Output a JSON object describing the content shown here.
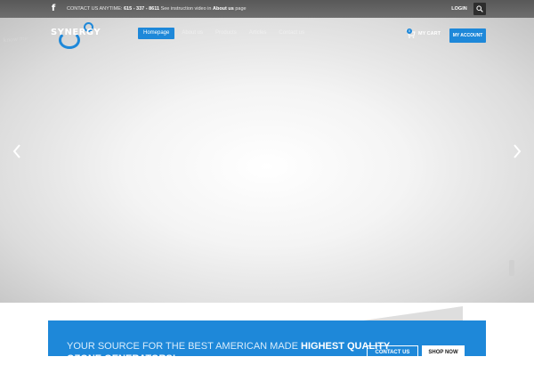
{
  "topbar": {
    "facebook_icon": "facebook-icon",
    "contact_prefix": "CONTACT US ANYTIME:",
    "phone": "615 - 337 - 8611",
    "video_text": "See instruction video in",
    "about_link": "About us",
    "page_suffix": "page",
    "login_label": "LOGIN",
    "search_icon": "search-icon"
  },
  "header": {
    "logo_text": "SYNERGY",
    "script_text": "know me",
    "nav": [
      {
        "label": "Homepage",
        "active": true
      },
      {
        "label": "About us",
        "active": false
      },
      {
        "label": "Products",
        "active": false
      },
      {
        "label": "Articles",
        "active": false
      },
      {
        "label": "Contact us",
        "active": false
      }
    ],
    "cart_count": "0",
    "cart_label": "MY CART",
    "account_label": "MY ACCOUNT"
  },
  "slider": {
    "prev_icon": "chevron-left-icon",
    "next_icon": "chevron-right-icon"
  },
  "banner": {
    "text_regular": "YOUR SOURCE FOR THE BEST AMERICAN MADE",
    "text_bold": "HIGHEST QUALITY",
    "text_line2": "OZONE GENERATORS!",
    "contact_button": "CONTACT US",
    "shop_button": "SHOP NOW"
  },
  "colors": {
    "accent": "#1e88d9",
    "topbar": "#666666",
    "hero_center": "#ffffff",
    "hero_edge": "#bdbdbd"
  }
}
